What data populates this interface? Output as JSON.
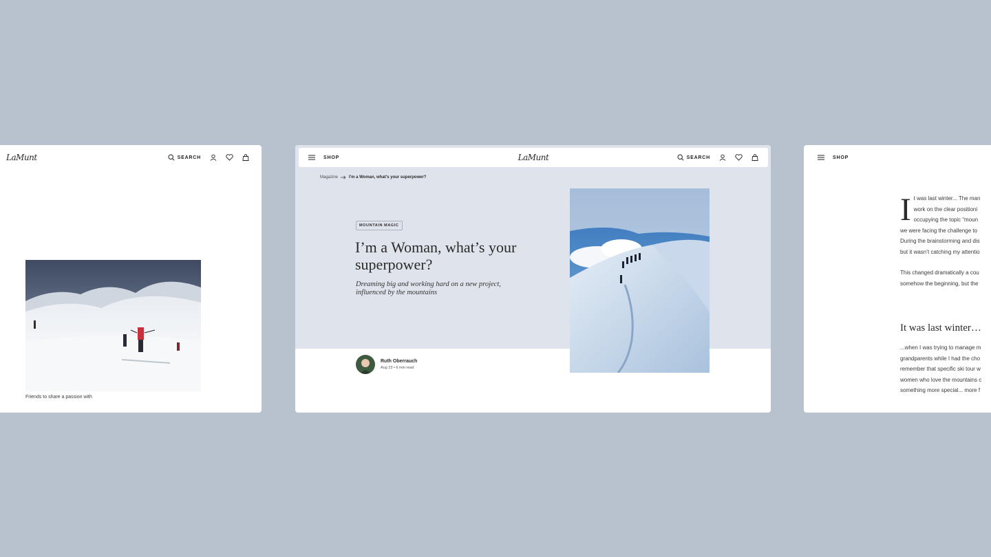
{
  "brand": {
    "logo_text": "LaMunt"
  },
  "nav": {
    "search_label": "SEARCH",
    "shop_label": "SHOP"
  },
  "left_card": {
    "caption": "Friends to share a passion with"
  },
  "center_card": {
    "breadcrumb": {
      "root": "Magazine",
      "current": "I'm a Woman, what's your superpower?"
    },
    "tag": "MOUNTAIN MAGIC",
    "title": "I’m a Woman, what’s your superpower?",
    "subtitle": "Dreaming big and working hard on a new project, influenced by the mountains",
    "author": {
      "name": "Ruth Oberrauch",
      "date": "Aug 23",
      "read_time": "6 min read"
    }
  },
  "right_card": {
    "drop_cap": "I",
    "intro_lines": [
      "t was last winter... The man",
      "work on the clear positioni",
      "occupying the topic “moun",
      "we were facing the challenge to",
      "During the brainstorming and dis",
      "but it wasn’t catching my attentio"
    ],
    "para2_lines": [
      "This changed dramatically a cou",
      "somehow the beginning, but the"
    ],
    "section_heading": "It was last winter…",
    "section_lines": [
      "...when I was trying to manage m",
      "grandparents while I had the cho",
      "remember that specific ski tour w",
      "women who love the mountains c",
      "something more special... more f"
    ]
  },
  "colors": {
    "page_background": "#b7c2ce",
    "hero_background": "#dfe4ec",
    "card_background": "#ffffff"
  }
}
